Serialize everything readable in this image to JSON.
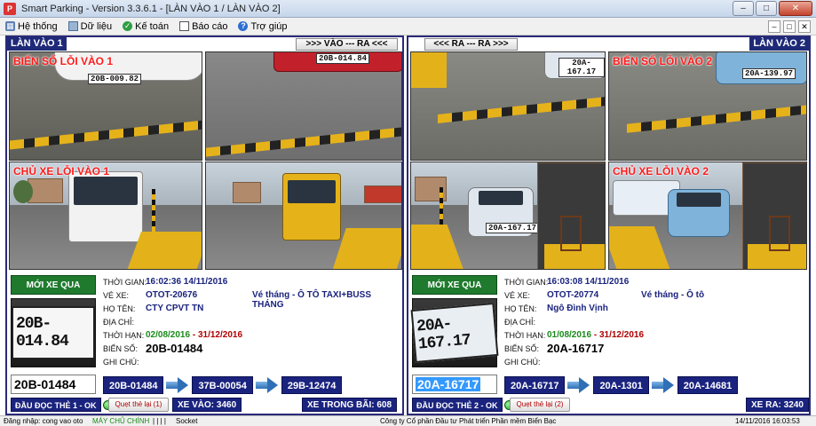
{
  "window": {
    "icon_text": "P",
    "title": "Smart Parking - Version 3.3.6.1 - [LÀN VÀO 1 / LÀN VÀO 2]",
    "btn_min": "–",
    "btn_max": "□",
    "btn_close": "✕"
  },
  "menu": {
    "items": [
      "Hệ thống",
      "Dữ liệu",
      "Kế toán",
      "Báo cáo",
      "Trợ giúp"
    ],
    "extra": [
      "–",
      "□",
      "✕"
    ]
  },
  "lanes": [
    {
      "header": "LÀN VÀO 1",
      "direction_button": ">>> VÀO  ---  RA <<<",
      "cam_labels": {
        "plate_error": "BIỂN SỐ LỖI VÀO 1",
        "driver_error": "CHỦ XE LỖI VÀO 1"
      },
      "cam_plates": [
        "20B-009.82",
        "20B-014.84"
      ],
      "new_car_label": "MỚI XE QUA",
      "plate_image_text": "20B-014.84",
      "plate_field": "20B-01484",
      "fields": {
        "time_label": "THỜI GIAN:",
        "time_value": "16:02:36 14/11/2016",
        "ticket_label": "VÉ XE:",
        "ticket_value": "OTOT-20676",
        "ticket_type": "Vé tháng - Ô TÔ TAXI+BUSS THÁNG",
        "name_label": "HỌ TÊN:",
        "name_value": "CTY CPVT TN",
        "address_label": "ĐỊA CHỈ:",
        "address_value": "",
        "period_label": "THỜI HẠN:",
        "period_start": "02/08/2016",
        "period_sep": " - ",
        "period_end": "31/12/2016",
        "plate_label": "BIỂN SỐ:",
        "plate_value": "20B-01484",
        "note_label": "GHI CHÚ:",
        "note_value": ""
      },
      "history": [
        "20B-01484",
        "37B-00054",
        "29B-12474"
      ],
      "reader_status": "ĐẦU ĐỌC THẺ 1 - OK",
      "retry_button": "Quẹt thẻ lại (1)",
      "count_a": "XE VÀO: 3460",
      "count_b": "XE TRONG BÃI: 608"
    },
    {
      "header": "LÀN VÀO 2",
      "direction_button": "<<< RA  ---  RA >>>",
      "cam_labels": {
        "plate_error": "BIỂN SỐ LỖI VÀO 2",
        "driver_error": "CHỦ XE  LỖI VÀO 2"
      },
      "cam_plates": [
        "20A-167.17",
        "20A-139.97",
        "20A-167.17"
      ],
      "new_car_label": "MỚI XE QUA",
      "plate_image_text": "20A-167.17",
      "plate_field": "20A-16717",
      "fields": {
        "time_label": "THỜI GIAN:",
        "time_value": "16:03:08 14/11/2016",
        "ticket_label": "VÉ XE:",
        "ticket_value": "OTOT-20774",
        "ticket_type": "Vé tháng - Ô tô",
        "name_label": "HỌ TÊN:",
        "name_value": "Ngô Đình Vịnh",
        "address_label": "ĐỊA CHỈ:",
        "address_value": "",
        "period_label": "THỜI HẠN:",
        "period_start": "01/08/2016",
        "period_sep": " - ",
        "period_end": "31/12/2016",
        "plate_label": "BIỂN SỐ:",
        "plate_value": "20A-16717",
        "note_label": "GHI CHÚ:",
        "note_value": ""
      },
      "history": [
        "20A-16717",
        "20A-1301",
        "20A-14681"
      ],
      "reader_status": "ĐẦU ĐỌC THẺ 2 - OK",
      "retry_button": "Quẹt thẻ lại (2)",
      "count_a": "XE RA: 3240"
    }
  ],
  "statusbar": {
    "login": "Đăng nhập: cong vao oto",
    "server": "MÁY CHỦ CHÍNH",
    "sep": "| | | |",
    "socket": "Socket",
    "company": "Công ty Cổ phần Đầu tư Phát triển Phần mềm Biển Bạc",
    "datetime": "14/11/2016 16:03:53"
  },
  "colors": {
    "lane_header_bg": "#1e2a78",
    "new_car_bg": "#1f7a2e",
    "label_red": "#ff1a1a",
    "value_blue": "#1a237e",
    "selection_blue": "#3399ff"
  },
  "icons": {
    "menu": [
      "system-icon",
      "data-icon",
      "accounting-icon",
      "report-icon",
      "help-icon"
    ],
    "arrow": "arrow-right-icon",
    "reader_ok": "status-led-icon"
  }
}
